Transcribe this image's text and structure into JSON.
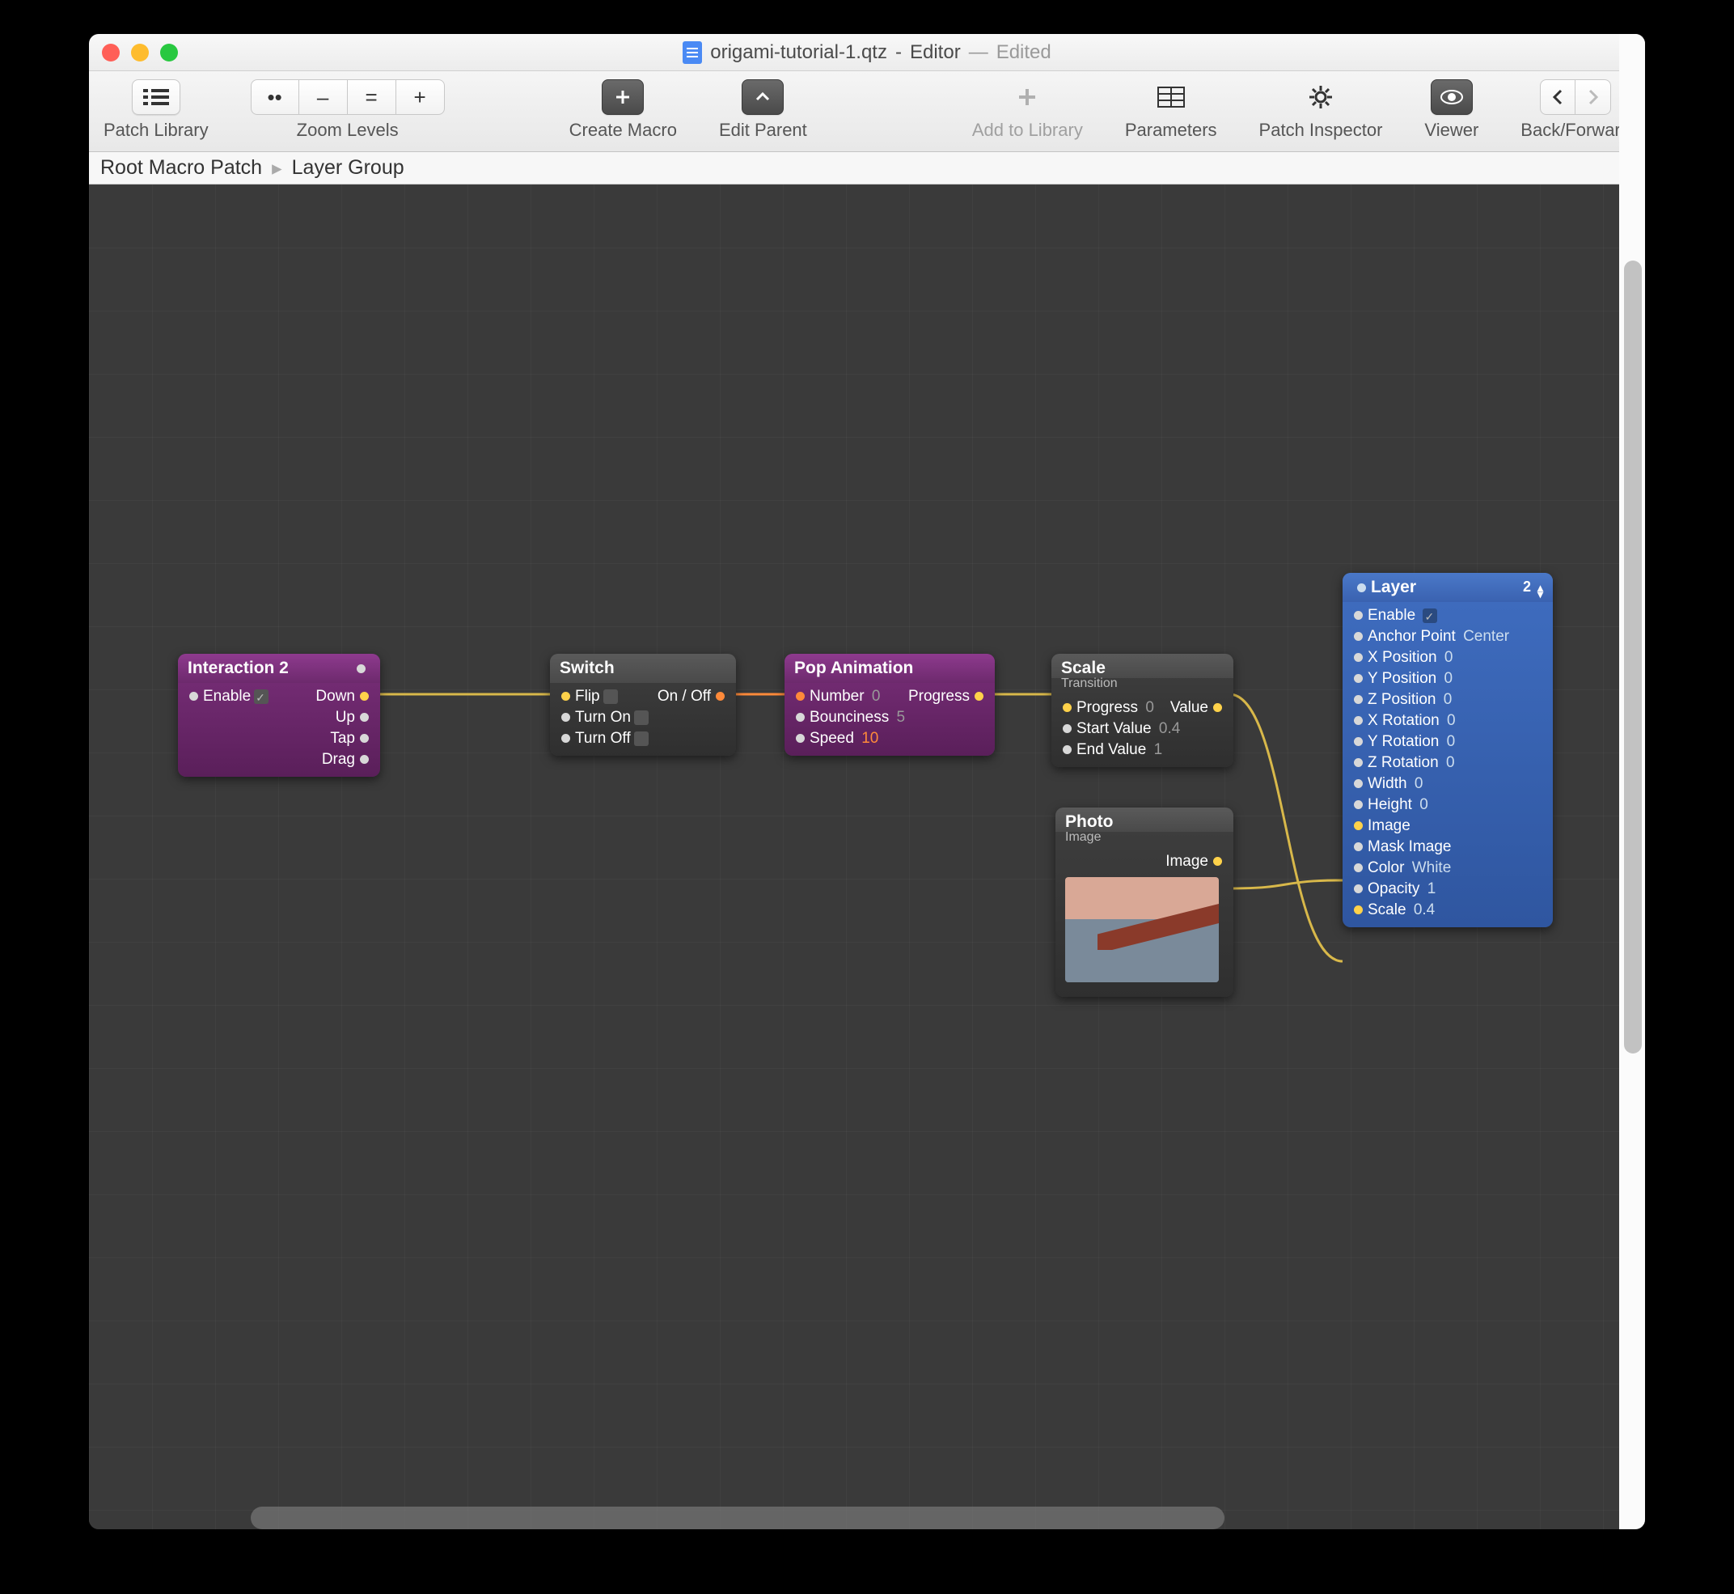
{
  "window": {
    "filename": "origami-tutorial-1.qtz",
    "app": "Editor",
    "edited": "Edited"
  },
  "toolbar": {
    "patch_library": "Patch Library",
    "zoom_levels": "Zoom Levels",
    "create_macro": "Create Macro",
    "edit_parent": "Edit Parent",
    "add_to_library": "Add to Library",
    "parameters": "Parameters",
    "patch_inspector": "Patch Inspector",
    "viewer": "Viewer",
    "back_forward": "Back/Forward",
    "zoom_fit": "••",
    "zoom_out": "–",
    "zoom_actual": "=",
    "zoom_in": "+"
  },
  "breadcrumb": {
    "root": "Root Macro Patch",
    "current": "Layer Group"
  },
  "nodes": {
    "interaction": {
      "title": "Interaction 2",
      "enable": "Enable",
      "down": "Down",
      "up": "Up",
      "tap": "Tap",
      "drag": "Drag"
    },
    "switch": {
      "title": "Switch",
      "flip": "Flip",
      "turn_on": "Turn On",
      "turn_off": "Turn Off",
      "on_off": "On / Off"
    },
    "pop": {
      "title": "Pop Animation",
      "number": "Number",
      "number_val": "0",
      "bounciness": "Bounciness",
      "bounciness_val": "5",
      "speed": "Speed",
      "speed_val": "10",
      "progress": "Progress"
    },
    "scale": {
      "title": "Scale",
      "subtitle": "Transition",
      "progress": "Progress",
      "progress_val": "0",
      "start": "Start Value",
      "start_val": "0.4",
      "end": "End Value",
      "end_val": "1",
      "value": "Value"
    },
    "photo": {
      "title": "Photo",
      "subtitle": "Image",
      "image": "Image"
    },
    "layer": {
      "title": "Layer",
      "index": "2",
      "enable": "Enable",
      "anchor": "Anchor Point",
      "anchor_val": "Center",
      "xpos": "X Position",
      "xpos_val": "0",
      "ypos": "Y Position",
      "ypos_val": "0",
      "zpos": "Z Position",
      "zpos_val": "0",
      "xrot": "X Rotation",
      "xrot_val": "0",
      "yrot": "Y Rotation",
      "yrot_val": "0",
      "zrot": "Z Rotation",
      "zrot_val": "0",
      "width": "Width",
      "width_val": "0",
      "height": "Height",
      "height_val": "0",
      "image": "Image",
      "mask": "Mask Image",
      "color": "Color",
      "color_val": "White",
      "opacity": "Opacity",
      "opacity_val": "1",
      "scale": "Scale",
      "scale_val": "0.4"
    }
  }
}
